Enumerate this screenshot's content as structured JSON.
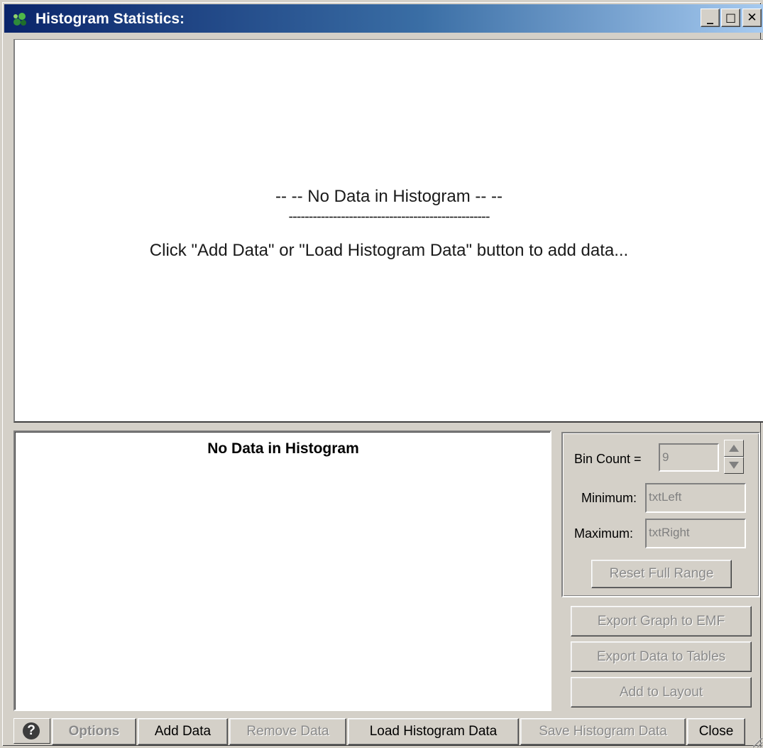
{
  "window": {
    "title": "Histogram Statistics:",
    "controls": {
      "minimize": "_",
      "maximize": "□",
      "close": "✕"
    }
  },
  "plot": {
    "no_data_heading": "-- -- No Data in Histogram -- --",
    "separator": "--------------------------------------------------",
    "instruction": "Click \"Add Data\" or \"Load Histogram Data\" button to add data..."
  },
  "stats": {
    "title": "No Data in Histogram"
  },
  "settings": {
    "bin_count_label": "Bin Count =",
    "bin_count_value": "9",
    "minimum_label": "Minimum:",
    "minimum_value": "txtLeft",
    "maximum_label": "Maximum:",
    "maximum_value": "txtRight",
    "reset_button": "Reset Full Range"
  },
  "side_buttons": {
    "export_graph": "Export Graph to EMF",
    "export_data": "Export Data to Tables",
    "add_to_layout": "Add to Layout"
  },
  "bottom_bar": {
    "help": "?",
    "options": "Options",
    "add_data": "Add Data",
    "remove_data": "Remove Data",
    "load_histogram_data": "Load Histogram Data",
    "save_histogram_data": "Save Histogram Data",
    "close": "Close"
  },
  "colors": {
    "titlebar_start": "#0a246a",
    "titlebar_end": "#a6caf0",
    "face": "#d4d0c8",
    "disabled_text": "#8a8a8a"
  }
}
